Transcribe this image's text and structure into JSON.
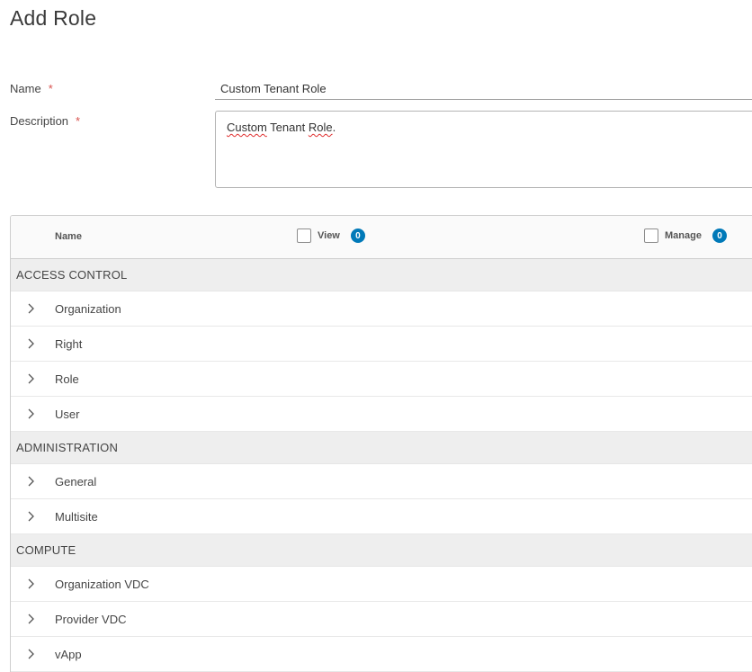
{
  "page": {
    "title": "Add Role"
  },
  "form": {
    "name_label": "Name",
    "name_required": "*",
    "name_value": "Custom Tenant Role",
    "description_label": "Description",
    "description_required": "*",
    "description_word1": "Custom",
    "description_word2": " Tenant ",
    "description_word3": "Role",
    "description_word4": "."
  },
  "grid": {
    "columns": {
      "name": "Name",
      "view": "View",
      "manage": "Manage"
    },
    "view_count": "0",
    "manage_count": "0",
    "groups": [
      {
        "label": "ACCESS CONTROL",
        "items": [
          "Organization",
          "Right",
          "Role",
          "User"
        ]
      },
      {
        "label": "ADMINISTRATION",
        "items": [
          "General",
          "Multisite"
        ]
      },
      {
        "label": "COMPUTE",
        "items": [
          "Organization VDC",
          "Provider VDC",
          "vApp"
        ]
      }
    ]
  },
  "icons": {
    "expand": "chevron-right-icon"
  },
  "colors": {
    "badge": "#0079b8",
    "required": "#d9534f",
    "group_bg": "#eeeeee"
  }
}
